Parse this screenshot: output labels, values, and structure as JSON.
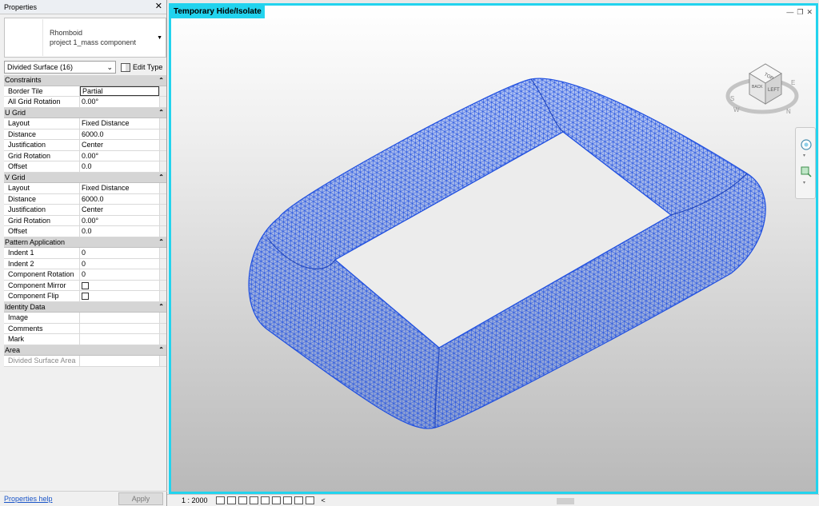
{
  "properties": {
    "title": "Properties",
    "type_name": "Rhomboid",
    "type_family": "project 1_mass component",
    "filter": "Divided Surface (16)",
    "edit_type": "Edit Type",
    "groups": [
      {
        "name": "Constraints",
        "rows": [
          {
            "key": "Border Tile",
            "value": "Partial",
            "editing": true
          },
          {
            "key": "All Grid Rotation",
            "value": "0.00°"
          }
        ]
      },
      {
        "name": "U Grid",
        "rows": [
          {
            "key": "Layout",
            "value": "Fixed Distance"
          },
          {
            "key": "Distance",
            "value": "6000.0"
          },
          {
            "key": "Justification",
            "value": "Center"
          },
          {
            "key": "Grid Rotation",
            "value": "0.00°"
          },
          {
            "key": "Offset",
            "value": "0.0"
          }
        ]
      },
      {
        "name": "V Grid",
        "rows": [
          {
            "key": "Layout",
            "value": "Fixed Distance"
          },
          {
            "key": "Distance",
            "value": "6000.0"
          },
          {
            "key": "Justification",
            "value": "Center"
          },
          {
            "key": "Grid Rotation",
            "value": "0.00°"
          },
          {
            "key": "Offset",
            "value": "0.0"
          }
        ]
      },
      {
        "name": "Pattern Application",
        "rows": [
          {
            "key": "Indent 1",
            "value": "0"
          },
          {
            "key": "Indent 2",
            "value": "0"
          },
          {
            "key": "Component Rotation",
            "value": "0"
          },
          {
            "key": "Component Mirror",
            "value": "",
            "checkbox": true
          },
          {
            "key": "Component Flip",
            "value": "",
            "checkbox": true
          }
        ]
      },
      {
        "name": "Identity Data",
        "rows": [
          {
            "key": "Image",
            "value": ""
          },
          {
            "key": "Comments",
            "value": ""
          },
          {
            "key": "Mark",
            "value": ""
          }
        ]
      },
      {
        "name": "Area",
        "rows": [
          {
            "key": "Divided Surface Area",
            "value": "",
            "dim": true
          }
        ]
      }
    ],
    "help_link": "Properties help",
    "apply": "Apply"
  },
  "viewport": {
    "mode_label": "Temporary Hide/Isolate",
    "mesh_color": "#1f4fe0",
    "highlight_color": "#22d3ee",
    "viewcube_faces": [
      "TOP",
      "BACK",
      "LEFT"
    ],
    "compass_letters": [
      "S",
      "E",
      "W",
      "N"
    ]
  },
  "statusbar": {
    "scale": "1 : 2000",
    "scroll_left": "<"
  },
  "icons": [
    "close-icon",
    "dropdown-arrow-icon",
    "edit-type-icon",
    "collapse-chevron-icon",
    "viewcube-icon",
    "steering-wheel-icon",
    "zoom-icon",
    "view-control-icons"
  ]
}
